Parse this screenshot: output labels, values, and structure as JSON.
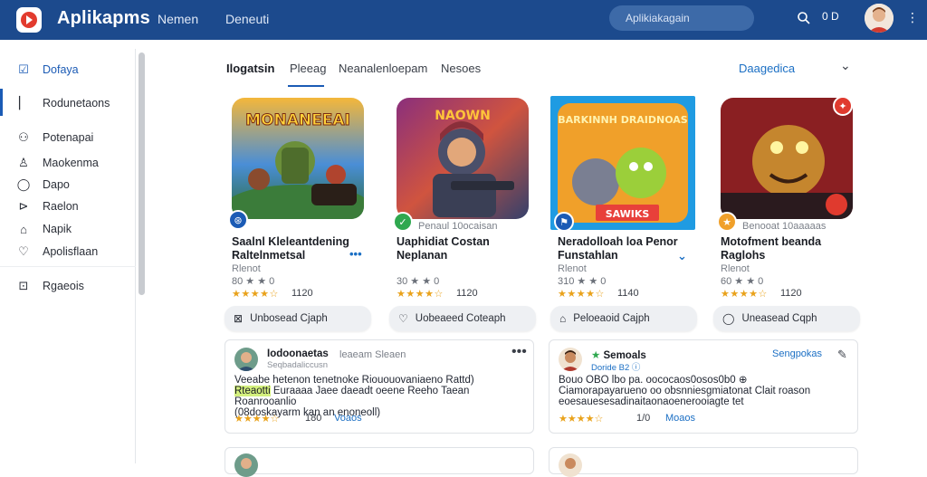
{
  "app": {
    "title": "Aplikapms",
    "nav": [
      "Nemen",
      "Deneuti"
    ],
    "search_placeholder": "Aplikiakagain",
    "top_counter": "0 D",
    "colors": {
      "header": "#1c4a8d",
      "accent": "#1b5bb5",
      "link": "#1b6fc4",
      "star": "#e9a21b"
    }
  },
  "sidebar": {
    "items": [
      {
        "label": "Dofaya",
        "icon": "checkbox-icon"
      },
      {
        "label": "Rodunetaons",
        "icon": "bar-icon"
      },
      {
        "label": "Potenapai",
        "icon": "user-icon"
      },
      {
        "label": "Maokenma",
        "icon": "person-icon"
      },
      {
        "label": "Dapo",
        "icon": "chat-icon"
      },
      {
        "label": "Raelon",
        "icon": "tag-icon"
      },
      {
        "label": "Napik",
        "icon": "bell-icon"
      },
      {
        "label": "Apolisflaan",
        "icon": "heart-icon"
      },
      {
        "label": "Rgaeois",
        "icon": "square-icon"
      }
    ]
  },
  "tabs": [
    "Ilogatsin",
    "Pleeag",
    "Neanalenloepam",
    "Nesoes"
  ],
  "sort": {
    "label": "Daagedica"
  },
  "games": [
    {
      "art_text": "MONANEEAI",
      "title": "Saalnl Kleleantdening Raltelnmetsal",
      "sub": "Rlenot",
      "meta": "80 ★ ★ 0",
      "stars": "★★★★☆",
      "rating": "1120",
      "more": "•••",
      "install": "Unbosead Cjaph",
      "badge": "bolt"
    },
    {
      "art_text": "NAOWN",
      "title": "Uaphidiat Costan Neplanan",
      "sub": "Penaul 10ocaisan",
      "meta": "30 ★ ★ 0",
      "stars": "★★★★☆",
      "rating": "1120",
      "more": "",
      "install": "Uobeaeed Coteaph",
      "badge": "check"
    },
    {
      "art_text": "BARKINNH DRAIDNOAS",
      "title": "Neradolloah loa Penor Funstahlan",
      "sub": "Rlenot",
      "meta": "310 ★ ★ 0",
      "stars": "★★★★☆",
      "rating": "1140",
      "more": "⌄",
      "install": "Peloeaoid Cajph",
      "badge": "flag",
      "banner": "SAWIKS"
    },
    {
      "art_text": "",
      "title": "Motofment beanda Raglohs",
      "sub": "Rlenot",
      "meta": "60 ★ ★ 0",
      "stars": "★★★★☆",
      "rating": "1120",
      "more": "",
      "install": "Uneasead Cqph",
      "badge": "star",
      "subtitle": "Benooat 10aaaaas"
    }
  ],
  "reviews": [
    {
      "name": "Iodoonaetas",
      "date": "leaeam Sleaen",
      "sub": "Seqbadaliccusn",
      "text_a": "Veeabe hetenon tenetnoke Riououovaniaeno Rattd)",
      "text_b": "Euraaaa Jaee daeadt oeene Reeho   Taean Roanrooanlio",
      "text_c": "(08doskayarm kan an enoneoll)",
      "highlight": "Rteaotti",
      "stars": "★★★★☆",
      "count": "180",
      "link": "Voaos",
      "dots": "•••"
    },
    {
      "name": "Semoals",
      "date": "",
      "sub": "Doride   B2 ⓘ",
      "text_a": "Bouo   OBO lbo pa.    oococaos0osos0b0 ⊕",
      "text_b": "Ciamorapayarueno oo obsnniesgmiatonat  Clait roason",
      "text_c": "eoesauesesadinaitaonaoenerooiagte tet",
      "highlight": "",
      "stars": "★★★★☆",
      "count": "1/0",
      "link": "Moaos",
      "action": "Sengpokas"
    }
  ]
}
